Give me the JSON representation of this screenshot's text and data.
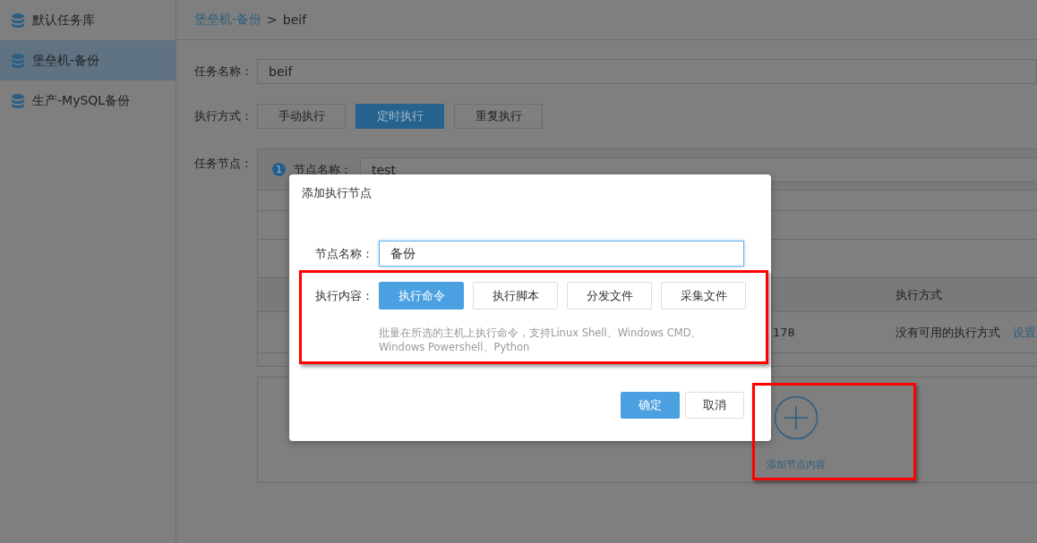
{
  "sidebar": {
    "items": [
      {
        "label": "默认任务库",
        "selected": false
      },
      {
        "label": "堡垒机-备份",
        "selected": true
      },
      {
        "label": "生产-MySQL备份",
        "selected": false
      }
    ]
  },
  "breadcrumb": {
    "parent": "堡垒机-备份",
    "separator": ">",
    "current": "beif"
  },
  "form": {
    "name_label": "任务名称：",
    "name_value": "beif",
    "mode_label": "执行方式：",
    "modes": [
      {
        "label": "手动执行",
        "selected": false
      },
      {
        "label": "定时执行",
        "selected": true
      },
      {
        "label": "重复执行",
        "selected": false
      }
    ],
    "nodes_label": "任务节点："
  },
  "node": {
    "number": "1",
    "name_label": "节点名称：",
    "name_value": "test",
    "table": {
      "columns": [
        "",
        "执行方式"
      ],
      "rows": [
        {
          "cells": [
            "178",
            "没有可用的执行方式"
          ],
          "link": "设置"
        }
      ]
    },
    "add_label": "添加节点内容"
  },
  "dialog": {
    "title": "添加执行节点",
    "name_label": "节点名称：",
    "name_value": "备份",
    "content_label": "执行内容：",
    "content_types": [
      {
        "label": "执行命令",
        "selected": true
      },
      {
        "label": "执行脚本",
        "selected": false
      },
      {
        "label": "分发文件",
        "selected": false
      },
      {
        "label": "采集文件",
        "selected": false
      }
    ],
    "hint": "批量在所选的主机上执行命令，支持Linux Shell、Windows CMD、Windows Powershell、Python",
    "buttons": [
      {
        "label": "确定",
        "kind": "primary"
      },
      {
        "label": "取消",
        "kind": "secondary"
      }
    ]
  }
}
